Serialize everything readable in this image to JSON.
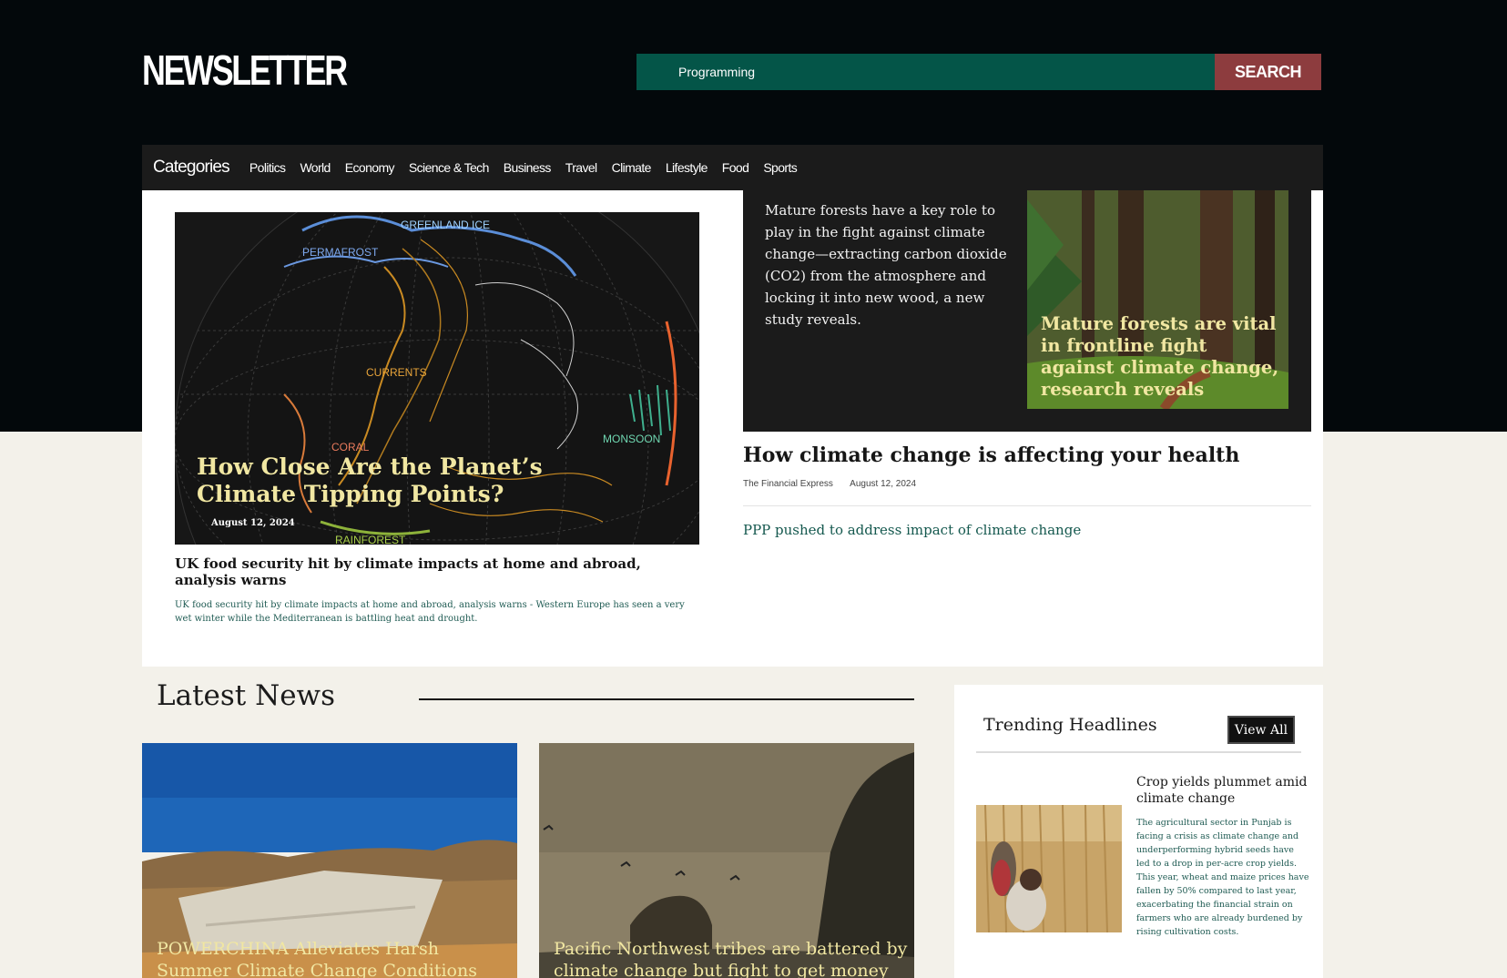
{
  "header": {
    "logo": "NEWSLETTER",
    "search_value": "Programming",
    "search_button": "SEARCH"
  },
  "categories": {
    "label": "Categories",
    "items": [
      "Politics",
      "World",
      "Economy",
      "Science & Tech",
      "Business",
      "Travel",
      "Climate",
      "Lifestyle",
      "Food",
      "Sports"
    ]
  },
  "hero": {
    "title": "How Close Are the Planet’s Climate Tipping Points?",
    "date": "August 12, 2024",
    "map_labels": [
      "GREENLAND ICE",
      "PERMAFROST",
      "CURRENTS",
      "CORAL",
      "MONSOON",
      "RAINFOREST"
    ]
  },
  "uk_article": {
    "title": "UK food security hit by climate impacts at home and abroad, analysis warns",
    "description": "UK food security hit by climate impacts at home and abroad, analysis warns - Western Europe has seen a very wet winter while the Mediterranean is battling heat and drought."
  },
  "forest_article": {
    "text": "Mature forests have a key role to play in the fight against climate change—extracting carbon dioxide (CO2) from the atmosphere and locking it into new wood, a new study reveals.",
    "title": "Mature forests are vital in frontline fight against climate change, research reveals"
  },
  "health_article": {
    "title": "How climate change is affecting your health",
    "source": "The Financial Express",
    "date": "August 12, 2024"
  },
  "ppp_link": "PPP pushed to address impact of climate change",
  "latest": {
    "heading": "Latest News",
    "cards": [
      {
        "title": "POWERCHINA Alleviates Harsh Summer Climate Change Conditions"
      },
      {
        "title": "Pacific Northwest tribes are battered by climate change but fight to get money"
      }
    ]
  },
  "trending": {
    "heading": "Trending Headlines",
    "view_all": "View All",
    "item": {
      "title": "Crop yields plummet amid climate change",
      "description": "The agricultural sector in Punjab is facing a crisis as climate change and underperforming hybrid seeds have led to a drop in per-acre crop yields. This year, wheat and maize prices have fallen by 50% compared to last year, exacerbating the financial strain on farmers who are already burdened by rising cultivation costs."
    }
  },
  "colors": {
    "header_bg": "#03080b",
    "search_bg": "#045548",
    "search_button_bg": "#8d3c3e",
    "headline_yellow": "#f1e7a2",
    "link_green": "#14584e",
    "page_bg": "#f3f1ea"
  }
}
